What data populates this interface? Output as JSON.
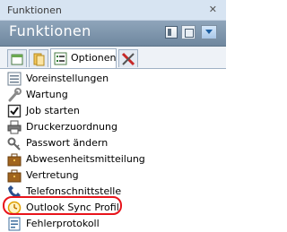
{
  "window": {
    "title": "Funktionen",
    "close_glyph": "✕"
  },
  "panel": {
    "title": "Funktionen"
  },
  "tabs": [
    {
      "icon": "document-icon"
    },
    {
      "icon": "folder-icon"
    },
    {
      "icon": "options-list-icon",
      "label": "Optionen"
    },
    {
      "icon": "tools-icon"
    }
  ],
  "items": [
    {
      "label": "Voreinstellungen",
      "icon": "list-settings-icon"
    },
    {
      "label": "Wartung",
      "icon": "wrench-icon"
    },
    {
      "label": "Job starten",
      "icon": "checkbox-icon"
    },
    {
      "label": "Druckerzuordnung",
      "icon": "printer-icon"
    },
    {
      "label": "Passwort ändern",
      "icon": "key-icon"
    },
    {
      "label": "Abwesenheitsmitteilung",
      "icon": "briefcase-icon"
    },
    {
      "label": "Vertretung",
      "icon": "briefcase-icon"
    },
    {
      "label": "Telefonschnittstelle",
      "icon": "phone-icon"
    },
    {
      "label": "Outlook Sync Profil",
      "icon": "clock-icon"
    },
    {
      "label": "Fehlerprotokoll",
      "icon": "log-icon"
    }
  ],
  "colors": {
    "highlight": "#e8141b",
    "header": "#7d93a9"
  }
}
